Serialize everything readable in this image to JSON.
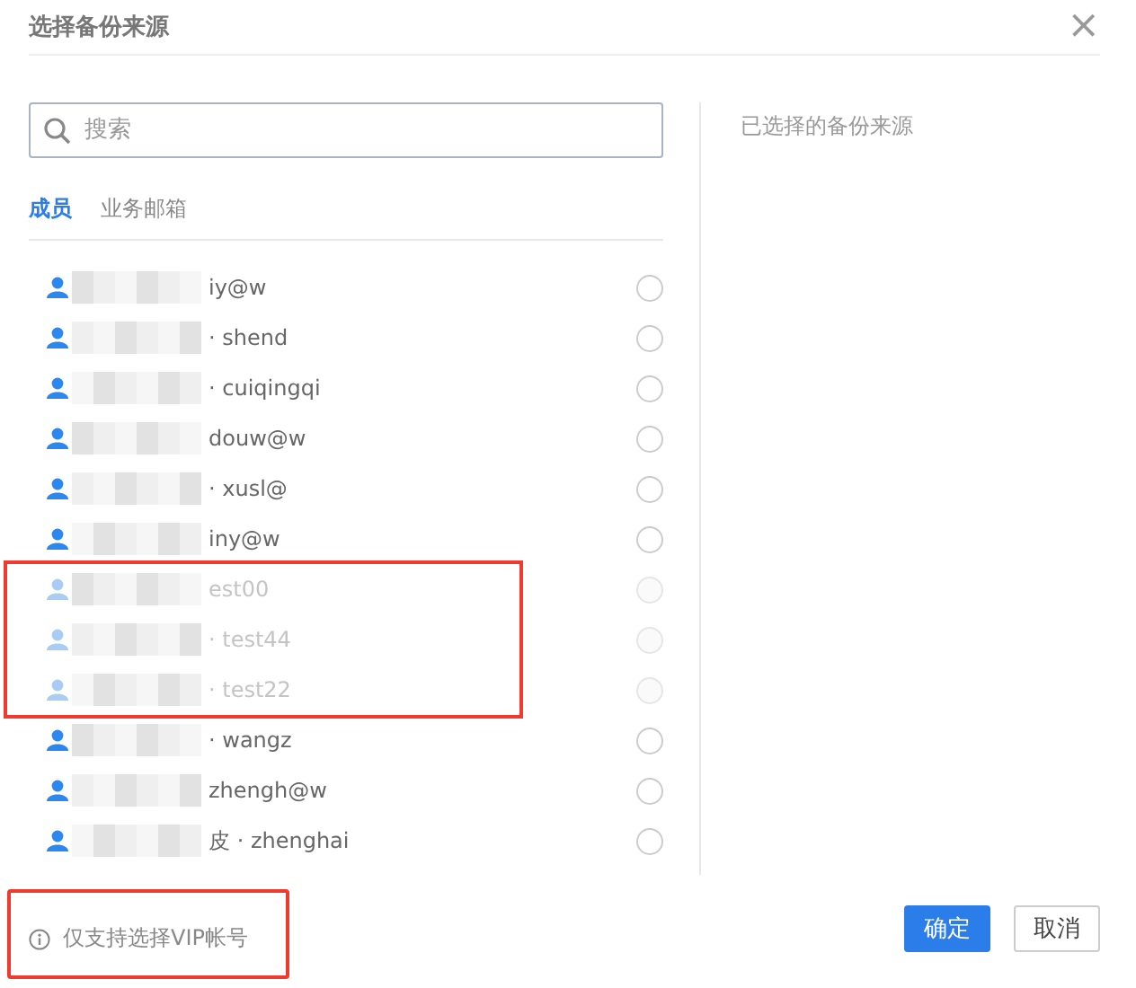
{
  "dialog": {
    "title": "选择备份来源",
    "close": "×"
  },
  "search": {
    "placeholder": "搜索"
  },
  "tabs": [
    {
      "label": "成员",
      "selected": true
    },
    {
      "label": "业务邮箱",
      "selected": false
    }
  ],
  "members": [
    {
      "text": "iy@w",
      "disabled": false,
      "selected": false,
      "highlighted": false
    },
    {
      "text": "· shend",
      "disabled": false,
      "selected": false,
      "highlighted": false
    },
    {
      "text": "· cuiqingqi",
      "disabled": false,
      "selected": false,
      "highlighted": false
    },
    {
      "text": "douw@w",
      "disabled": false,
      "selected": false,
      "highlighted": false
    },
    {
      "text": "· xusl@",
      "disabled": false,
      "selected": false,
      "highlighted": false
    },
    {
      "text": "iny@w",
      "disabled": false,
      "selected": false,
      "highlighted": false
    },
    {
      "text": "est00",
      "disabled": true,
      "selected": false,
      "highlighted": true
    },
    {
      "text": "· test44",
      "disabled": true,
      "selected": false,
      "highlighted": true
    },
    {
      "text": "· test22",
      "disabled": true,
      "selected": false,
      "highlighted": true
    },
    {
      "text": "· wangz",
      "disabled": false,
      "selected": false,
      "highlighted": false
    },
    {
      "text": "zhengh@w",
      "disabled": false,
      "selected": false,
      "highlighted": false
    },
    {
      "text": "皮 · zhenghai",
      "disabled": false,
      "selected": false,
      "highlighted": false
    }
  ],
  "selected_panel": {
    "title": "已选择的备份来源"
  },
  "note": {
    "text": "仅支持选择VIP帐号",
    "highlighted": true
  },
  "buttons": [
    {
      "label": "确定",
      "kind": "primary"
    },
    {
      "label": "取消",
      "kind": "secondary"
    }
  ]
}
